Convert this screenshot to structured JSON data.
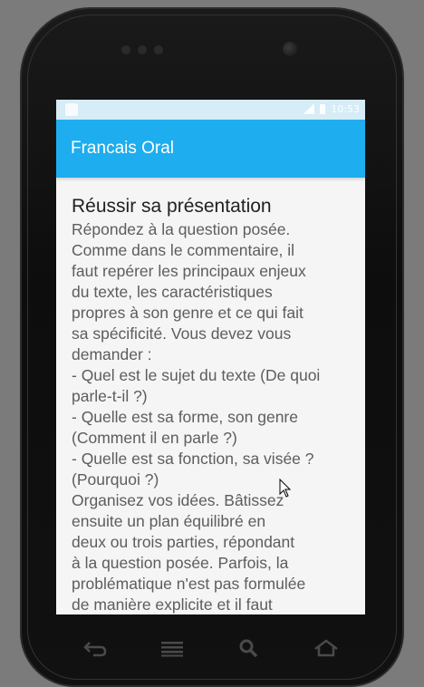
{
  "app": {
    "title": "Francais Oral"
  },
  "status_bar": {
    "time": "10:53"
  },
  "article": {
    "title": "Réussir sa présentation",
    "lines": [
      "Répondez à la question posée.",
      "Comme dans le commentaire, il",
      "faut repérer les principaux enjeux",
      "du texte, les caractéristiques",
      "propres à son genre et ce qui fait",
      "sa spécificité. Vous devez vous",
      "demander :",
      "- Quel est le sujet du texte (De quoi",
      "parle-t-il ?)",
      "- Quelle est sa forme, son genre",
      "(Comment il en parle ?)",
      "- Quelle est sa fonction, sa visée ?",
      "(Pourquoi ?)",
      "Organisez vos idées. Bâtissez",
      "ensuite un plan équilibré en",
      "deux ou trois parties, répondant",
      "à la question posée. Parfois, la",
      "problématique n'est pas formulée",
      "de manière explicite et il faut"
    ]
  },
  "colors": {
    "appbar": "#1eadee",
    "text": "#5d5d5d",
    "title": "#222222"
  },
  "nav": {
    "icons": [
      "back-icon",
      "menu-icon",
      "search-icon",
      "home-icon"
    ]
  }
}
